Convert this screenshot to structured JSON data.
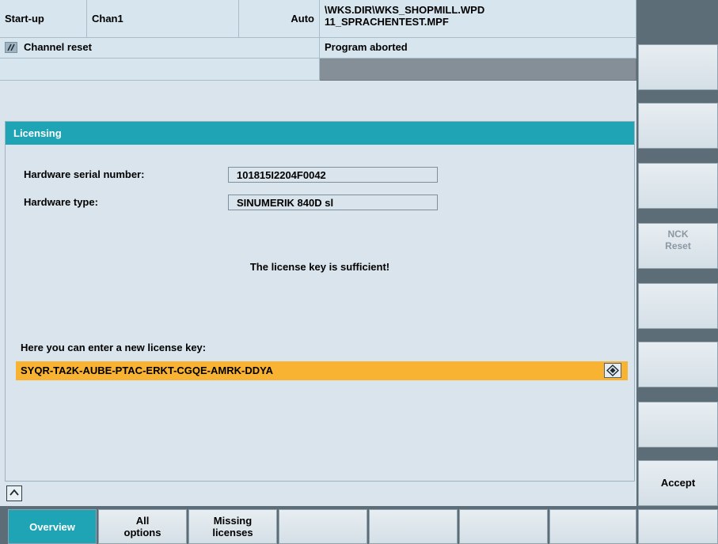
{
  "header": {
    "mode": "Start-up",
    "channel": "Chan1",
    "op_mode": "Auto",
    "program_path": "\\WKS.DIR\\WKS_SHOPMILL.WPD",
    "program_name": "11_SPRACHENTEST.MPF",
    "channel_status": "Channel reset",
    "program_status": "Program aborted"
  },
  "window": {
    "title": "Licensing",
    "hw_serial_label": "Hardware serial number:",
    "hw_serial_value": "101815I2204F0042",
    "hw_type_label": "Hardware type:",
    "hw_type_value": "SINUMERIK 840D sl",
    "status_message": "The license key is sufficient!",
    "new_key_label": "Here you can enter a new license key:",
    "license_key": "SYQR-TA2K-AUBE-PTAC-ERKT-CGQE-AMRK-DDYA"
  },
  "vertical_softkeys": {
    "nck_reset_line1": "NCK",
    "nck_reset_line2": "Reset",
    "accept": "Accept"
  },
  "horizontal_softkeys": {
    "overview": "Overview",
    "all_options_line1": "All",
    "all_options_line2": "options",
    "missing_line1": "Missing",
    "missing_line2": "licenses"
  },
  "colors": {
    "accent": "#1fa4b6",
    "key_field": "#f9b332",
    "softkey_bar": "#5d6d78",
    "disabled_text": "#8b98a2"
  },
  "icons": {
    "reset": "channel-reset-icon",
    "edit": "edit-field-icon",
    "expand": "expand-up-icon"
  }
}
